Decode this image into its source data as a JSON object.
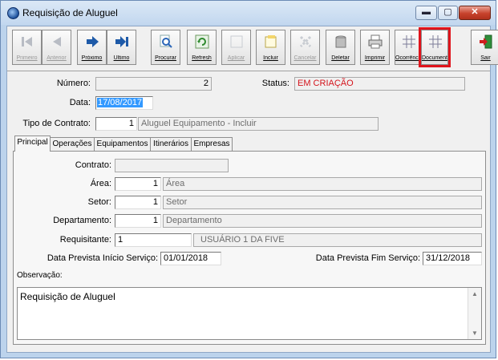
{
  "window": {
    "title": "Requisição de Aluguel",
    "min": "▬",
    "max": "▢",
    "close": "✕"
  },
  "toolbar": [
    {
      "label": "Primeiro",
      "icon": "first-icon",
      "enabled": false
    },
    {
      "label": "Anterior",
      "icon": "previous-icon",
      "enabled": false
    },
    {
      "label": "Próximo",
      "icon": "next-icon",
      "enabled": true
    },
    {
      "label": "Último",
      "icon": "last-icon",
      "enabled": true
    },
    {
      "label": "Procurar",
      "icon": "search-icon",
      "enabled": true
    },
    {
      "label": "Refresh",
      "icon": "refresh-icon",
      "enabled": true
    },
    {
      "label": "Aplicar",
      "icon": "apply-icon",
      "enabled": false
    },
    {
      "label": "Incluir",
      "icon": "add-icon",
      "enabled": true
    },
    {
      "label": "Cancelar",
      "icon": "cancel-icon",
      "enabled": false
    },
    {
      "label": "Deletar",
      "icon": "delete-icon",
      "enabled": true
    },
    {
      "label": "Imprimir",
      "icon": "print-icon",
      "enabled": true
    },
    {
      "label": "Ocorrência",
      "icon": "grid-icon",
      "enabled": true
    },
    {
      "label": "Documento",
      "icon": "grid-icon",
      "enabled": true,
      "highlighted": true
    },
    {
      "label": "Sair",
      "icon": "exit-icon",
      "enabled": true
    }
  ],
  "header": {
    "numero_label": "Número:",
    "numero_value": "2",
    "status_label": "Status:",
    "status_value": "EM CRIAÇÃO",
    "status_color": "#d4141c",
    "data_label": "Data:",
    "data_value": "17/08/2017",
    "tipo_label": "Tipo de Contrato:",
    "tipo_code": "1",
    "tipo_desc": "Aluguel Equipamento - Incluir"
  },
  "tabs": [
    "Principal",
    "Operações",
    "Equipamentos",
    "Itinerários",
    "Empresas"
  ],
  "principal": {
    "contrato_label": "Contrato:",
    "contrato_value": "",
    "area_label": "Área:",
    "area_code": "1",
    "area_desc": "Área",
    "setor_label": "Setor:",
    "setor_code": "1",
    "setor_desc": "Setor",
    "departamento_label": "Departamento:",
    "departamento_code": "1",
    "departamento_desc": "Departamento",
    "requisitante_label": "Requisitante:",
    "requisitante_code": "1",
    "requisitante_desc": "USUÁRIO 1 DA FIVE",
    "inicio_label": "Data Prevista Início Serviço:",
    "inicio_value": "01/01/2018",
    "fim_label": "Data Prevista Fim Serviço:",
    "fim_value": "31/12/2018",
    "observacao_label": "Observação:",
    "observacao_value": "Requisição de Aluguel"
  }
}
